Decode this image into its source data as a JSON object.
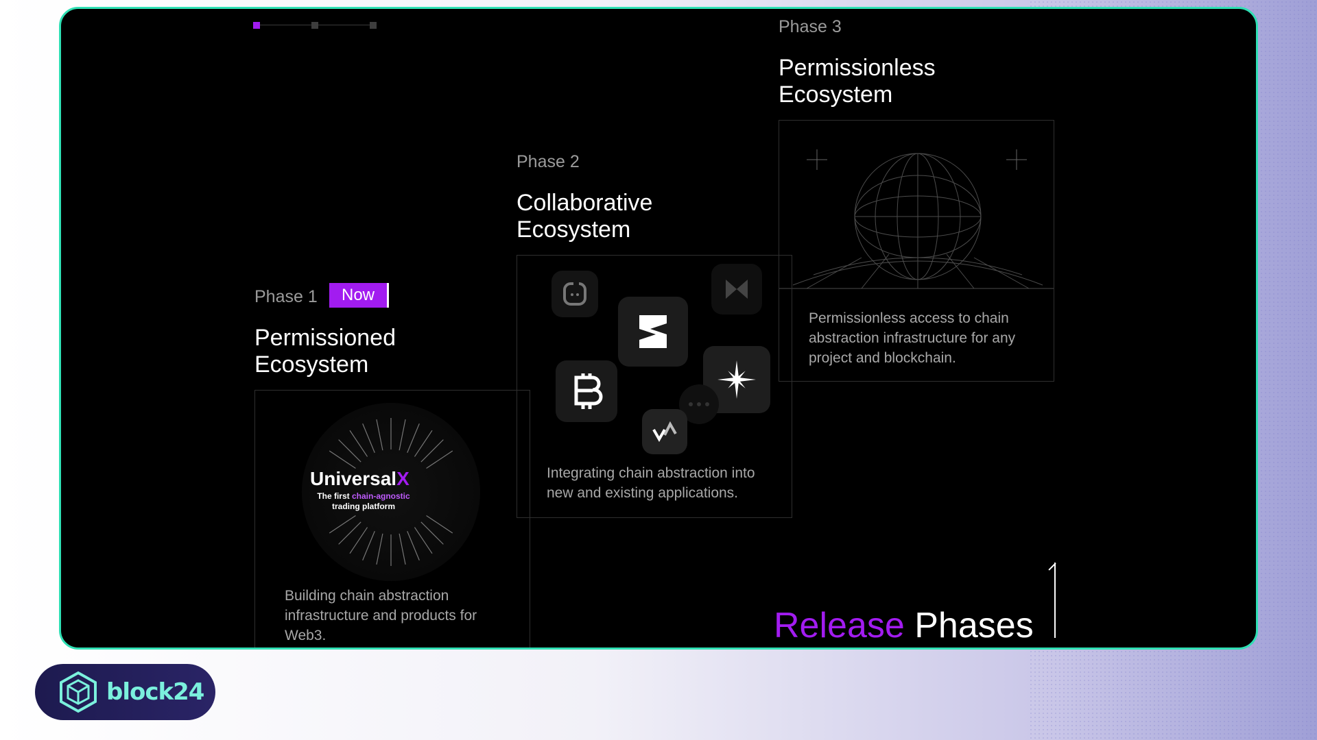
{
  "phase1": {
    "label": "Phase 1",
    "badge": "Now",
    "title": "Permissioned\nEcosystem",
    "product_name_main": "Universal",
    "product_name_accent": "X",
    "product_tagline_pre": "The first ",
    "product_tagline_highlight": "chain-agnostic",
    "product_tagline_post": "trading platform",
    "description": "Building chain abstraction infrastructure and products for Web3."
  },
  "phase2": {
    "label": "Phase 2",
    "title": "Collaborative\nEcosystem",
    "description": "Integrating chain abstraction into new and existing applications.",
    "apps": [
      "chat-app-icon",
      "s-logo-icon",
      "hourglass-logo-icon",
      "bitcoin-b-icon",
      "starburst-logo-icon",
      "more-dots-icon",
      "wave-logo-icon"
    ]
  },
  "phase3": {
    "label": "Phase 3",
    "title": "Permissionless\nEcosystem",
    "description": "Permissionless access to chain abstraction infrastructure for any project and blockchain."
  },
  "headline": {
    "highlight": "Release",
    "rest": " Phases"
  },
  "brand": {
    "name": "block24"
  },
  "colors": {
    "accent": "#a21cf0",
    "frame_border": "#2fe0b4",
    "brand_text": "#7bf0dd"
  },
  "stepper": {
    "steps": 3,
    "active": 1
  }
}
